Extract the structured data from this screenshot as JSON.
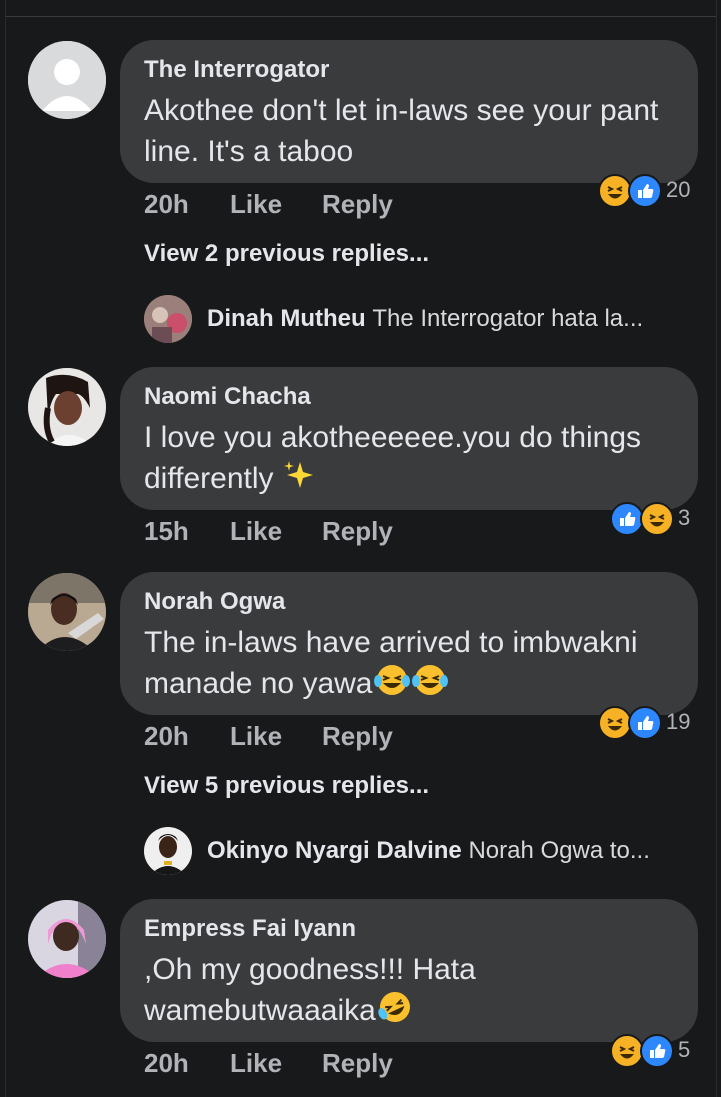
{
  "comments": [
    {
      "author": "The Interrogator",
      "text": "Akothee don't let in-laws see your pant line. It's a taboo",
      "time": "20h",
      "like": "Like",
      "reply": "Reply",
      "reaction_count": "20",
      "view_more": "View 2 previous replies...",
      "reply_preview": {
        "name": "Dinah Mutheu",
        "text": "The Interrogator hata la..."
      }
    },
    {
      "author": "Naomi Chacha",
      "text": "I love you akotheeeeee.you do things differently",
      "time": "15h",
      "like": "Like",
      "reply": "Reply",
      "reaction_count": "3"
    },
    {
      "author": "Norah Ogwa",
      "text": "The in-laws have arrived to imbwakni manade no yawa",
      "time": "20h",
      "like": "Like",
      "reply": "Reply",
      "reaction_count": "19",
      "view_more": "View 5 previous replies...",
      "reply_preview": {
        "name": "Okinyo Nyargi Dalvine",
        "text": "Norah Ogwa to..."
      }
    },
    {
      "author": "Empress Fai Iyann",
      "text": ",Oh my goodness!!! Hata wamebutwaaaika",
      "time": "20h",
      "like": "Like",
      "reply": "Reply",
      "reaction_count": "5"
    }
  ],
  "colors": {
    "background": "#18191a",
    "bubble": "#3a3b3c",
    "like_blue": "#2d88ff",
    "haha_yellow": "#f7b125"
  }
}
